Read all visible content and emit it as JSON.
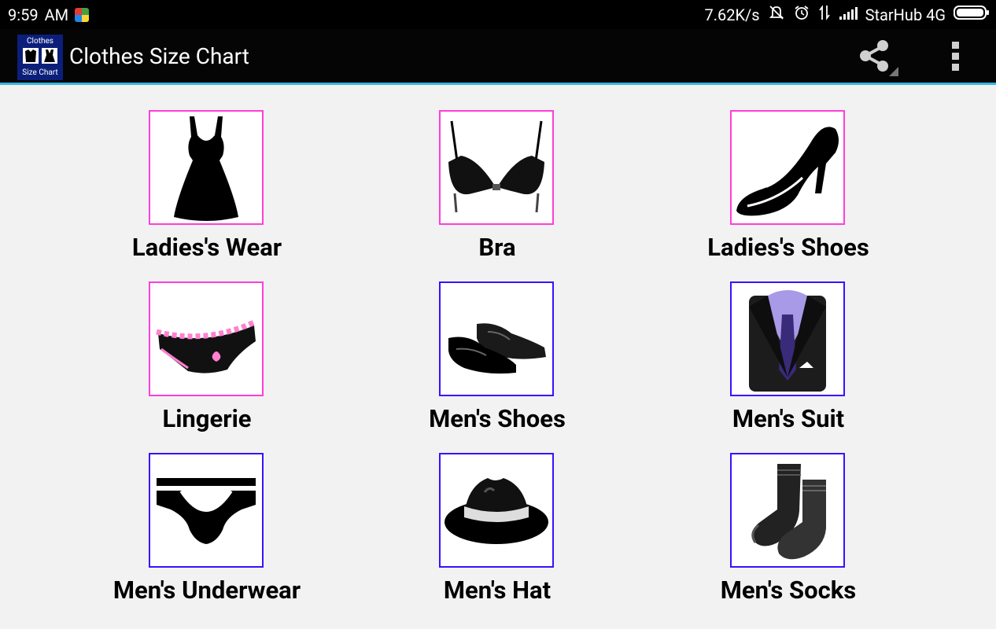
{
  "status_bar": {
    "time": "9:59",
    "ampm": "AM",
    "speed": "7.62K/s",
    "carrier": "StarHub 4G"
  },
  "app_bar": {
    "logo_top": "Clothes",
    "logo_bottom": "Size Chart",
    "title": "Clothes Size Chart",
    "share_icon": "share-icon",
    "menu_icon": "overflow-menu-icon"
  },
  "categories": [
    {
      "label": "Ladies's Wear",
      "icon": "dress-icon",
      "color": "#ff3fd8"
    },
    {
      "label": "Bra",
      "icon": "bra-icon",
      "color": "#ff3fd8"
    },
    {
      "label": "Ladies's Shoes",
      "icon": "high-heel-icon",
      "color": "#ff3fd8"
    },
    {
      "label": "Lingerie",
      "icon": "panties-icon",
      "color": "#ff3fd8"
    },
    {
      "label": "Men's Shoes",
      "icon": "mens-shoes-icon",
      "color": "#3a10ff"
    },
    {
      "label": "Men's Suit",
      "icon": "suit-icon",
      "color": "#3a10ff"
    },
    {
      "label": "Men's Underwear",
      "icon": "briefs-icon",
      "color": "#3a10ff"
    },
    {
      "label": "Men's Hat",
      "icon": "fedora-icon",
      "color": "#3a10ff"
    },
    {
      "label": "Men's Socks",
      "icon": "socks-icon",
      "color": "#3a10ff"
    }
  ],
  "colors": {
    "accent": "#33b5e5",
    "women_border": "#ff3fd8",
    "men_border": "#3a10ff",
    "background": "#f2f2f2"
  }
}
